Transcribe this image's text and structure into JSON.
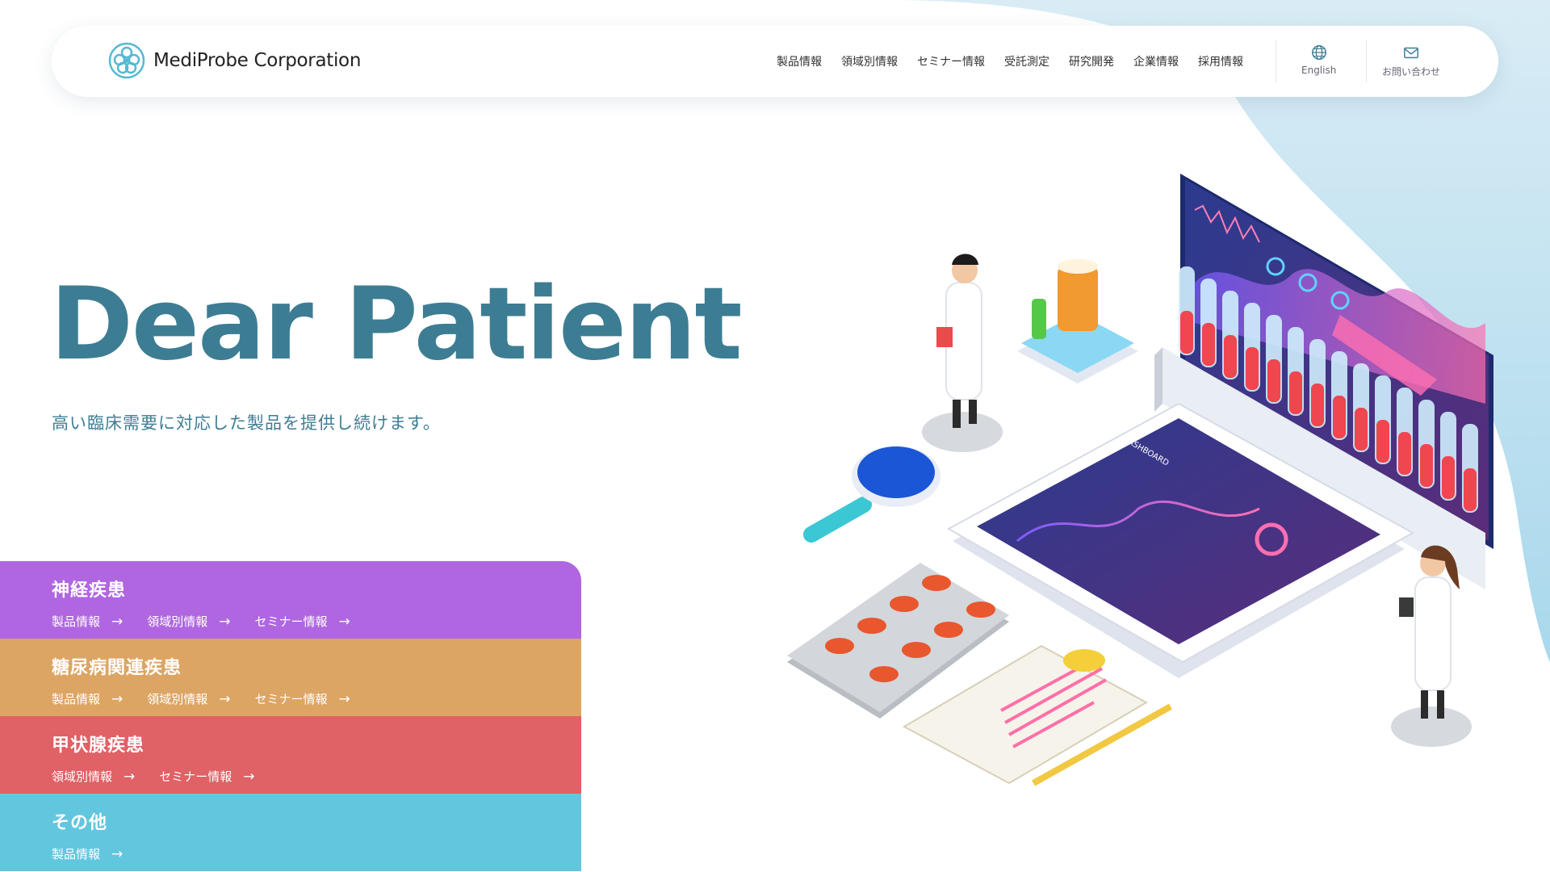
{
  "brand": {
    "name": "MediProbe Corporation",
    "logo_icon": "molecule-flower-icon"
  },
  "nav": {
    "items": [
      "製品情報",
      "領域別情報",
      "セミナー情報",
      "受託測定",
      "研究開発",
      "企業情報",
      "採用情報"
    ],
    "english_label": "English",
    "contact_label": "お問い合わせ"
  },
  "hero": {
    "title": "Dear Patient",
    "subtitle": "高い臨床需要に対応した製品を提供し続けます。"
  },
  "categories": [
    {
      "title": "神経疾患",
      "color": "#b066e0",
      "links": [
        "製品情報",
        "領域別情報",
        "セミナー情報"
      ]
    },
    {
      "title": "糖尿病関連疾患",
      "color": "#dda564",
      "links": [
        "製品情報",
        "領域別情報",
        "セミナー情報"
      ]
    },
    {
      "title": "甲状腺疾患",
      "color": "#e06166",
      "links": [
        "領域別情報",
        "セミナー情報"
      ]
    },
    {
      "title": "その他",
      "color": "#63c6df",
      "links": [
        "製品情報"
      ]
    }
  ],
  "illustration": {
    "screen_label": "DASHBOARD"
  },
  "colors": {
    "accent": "#3d7d93",
    "blob": "#cfe8f3"
  }
}
